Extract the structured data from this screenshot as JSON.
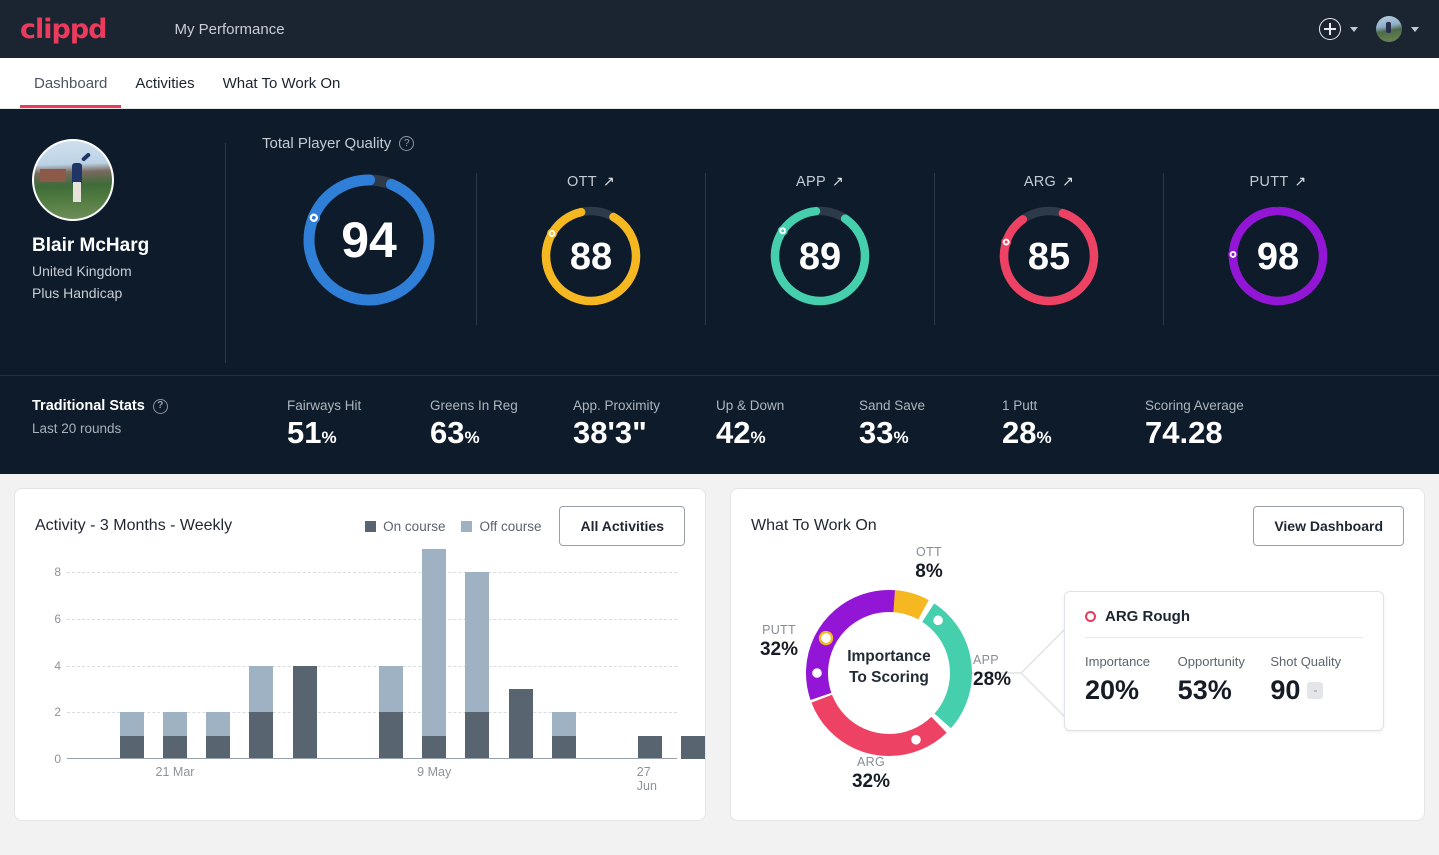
{
  "brand": {
    "logo_text": "clippd",
    "accent": "#ec3a5d"
  },
  "topbar": {
    "app_title": "My Performance",
    "add_icon": "plus-circle-icon",
    "avatar_icon": "user-avatar-icon"
  },
  "tabs": [
    {
      "label": "Dashboard",
      "active": true
    },
    {
      "label": "Activities",
      "active": false
    },
    {
      "label": "What To Work On",
      "active": false
    }
  ],
  "player": {
    "name": "Blair McHarg",
    "country": "United Kingdom",
    "handicap": "Plus Handicap"
  },
  "tpq": {
    "title": "Total Player Quality",
    "help_icon": "question-circle-icon",
    "value": "94",
    "color": "#2f7ed8",
    "pct": 94
  },
  "gauges": [
    {
      "label": "OTT",
      "trend_icon": "arrow-up-right-icon",
      "value": "88",
      "color": "#f5b820",
      "pct": 88
    },
    {
      "label": "APP",
      "trend_icon": "arrow-up-right-icon",
      "value": "89",
      "color": "#45cfad",
      "pct": 89
    },
    {
      "label": "ARG",
      "trend_icon": "arrow-up-right-icon",
      "value": "85",
      "color": "#ee4264",
      "pct": 85
    },
    {
      "label": "PUTT",
      "trend_icon": "arrow-up-right-icon",
      "value": "98",
      "color": "#9315d6",
      "pct": 98
    }
  ],
  "traditional": {
    "title": "Traditional Stats",
    "help_icon": "question-circle-icon",
    "subtitle": "Last 20 rounds",
    "stats": [
      {
        "label": "Fairways Hit",
        "value": "51",
        "unit": "%"
      },
      {
        "label": "Greens In Reg",
        "value": "63",
        "unit": "%"
      },
      {
        "label": "App. Proximity",
        "value": "38'3\"",
        "unit": ""
      },
      {
        "label": "Up & Down",
        "value": "42",
        "unit": "%"
      },
      {
        "label": "Sand Save",
        "value": "33",
        "unit": "%"
      },
      {
        "label": "1 Putt",
        "value": "28",
        "unit": "%"
      },
      {
        "label": "Scoring Average",
        "value": "74.28",
        "unit": ""
      }
    ]
  },
  "activity": {
    "title": "Activity - 3 Months - Weekly",
    "legend": [
      {
        "label": "On course",
        "color": "#58646f"
      },
      {
        "label": "Off course",
        "color": "#9fb2c4"
      }
    ],
    "button": "All Activities"
  },
  "chart_data": {
    "type": "bar",
    "title": "Activity - 3 Months - Weekly",
    "stacked": true,
    "xlabel": "",
    "ylabel": "",
    "ylim": [
      0,
      9
    ],
    "yticks": [
      0,
      2,
      4,
      6,
      8
    ],
    "grid": true,
    "legend_position": "top-right",
    "categories": [
      "w1",
      "w2",
      "w3",
      "w4",
      "w5",
      "w6",
      "w7",
      "w8",
      "w9",
      "w10",
      "w11",
      "w12",
      "w13",
      "w14",
      "w15"
    ],
    "tick_labels": [
      {
        "index": 2,
        "label": "21 Mar"
      },
      {
        "index": 8,
        "label": "9 May"
      },
      {
        "index": 13,
        "label": "27 Jun"
      }
    ],
    "series": [
      {
        "name": "On course",
        "color": "#58646f",
        "values": [
          0,
          1,
          1,
          1,
          2,
          4,
          0,
          2,
          1,
          2,
          3,
          1,
          0,
          1,
          1
        ]
      },
      {
        "name": "Off course",
        "color": "#9fb2c4",
        "values": [
          0,
          1,
          1,
          1,
          2,
          0,
          0,
          2,
          8,
          6,
          0,
          1,
          0,
          0,
          0
        ]
      }
    ]
  },
  "wtwo": {
    "title": "What To Work On",
    "button": "View Dashboard",
    "center_line1": "Importance",
    "center_line2": "To Scoring",
    "donut": {
      "type": "donut",
      "segments": [
        {
          "label": "OTT",
          "value": 8,
          "color": "#f5b820"
        },
        {
          "label": "APP",
          "value": 28,
          "color": "#45cfad"
        },
        {
          "label": "ARG",
          "value": 32,
          "color": "#ee4264"
        },
        {
          "label": "PUTT",
          "value": 32,
          "color": "#9315d6"
        }
      ]
    },
    "labels": [
      {
        "key": "OTT",
        "value": "8%"
      },
      {
        "key": "APP",
        "value": "28%"
      },
      {
        "key": "ARG",
        "value": "32%"
      },
      {
        "key": "PUTT",
        "value": "32%"
      }
    ],
    "detail": {
      "marker_icon": "ring-dot-icon",
      "title": "ARG Rough",
      "metrics": [
        {
          "label": "Importance",
          "value": "20%",
          "badge": ""
        },
        {
          "label": "Opportunity",
          "value": "53%",
          "badge": ""
        },
        {
          "label": "Shot Quality",
          "value": "90",
          "badge": "-"
        }
      ]
    }
  }
}
